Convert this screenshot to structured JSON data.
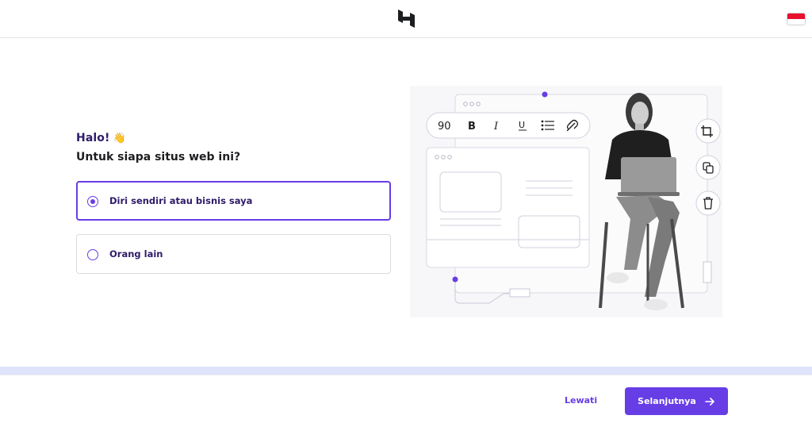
{
  "header": {
    "logo_icon": "hostinger-logo-icon",
    "language_flag": "indonesia-flag-icon"
  },
  "intro": {
    "greeting": "Halo!",
    "greeting_emoji": "👋",
    "question": "Untuk siapa situs web ini?"
  },
  "options": [
    {
      "label": "Diri sendiri atau bisnis saya",
      "selected": true
    },
    {
      "label": "Orang lain",
      "selected": false
    }
  ],
  "illustration": {
    "toolbar_value": "90",
    "toolbar_icons": [
      "bold-icon",
      "italic-icon",
      "underline-icon",
      "list-icon",
      "link-icon"
    ],
    "side_icons": [
      "crop-icon",
      "copy-icon",
      "trash-icon"
    ]
  },
  "footer": {
    "skip_label": "Lewati",
    "next_label": "Selanjutnya"
  },
  "colors": {
    "accent": "#673de6",
    "progress_track": "#dfe3fb",
    "heading": "#2f1c6a"
  }
}
